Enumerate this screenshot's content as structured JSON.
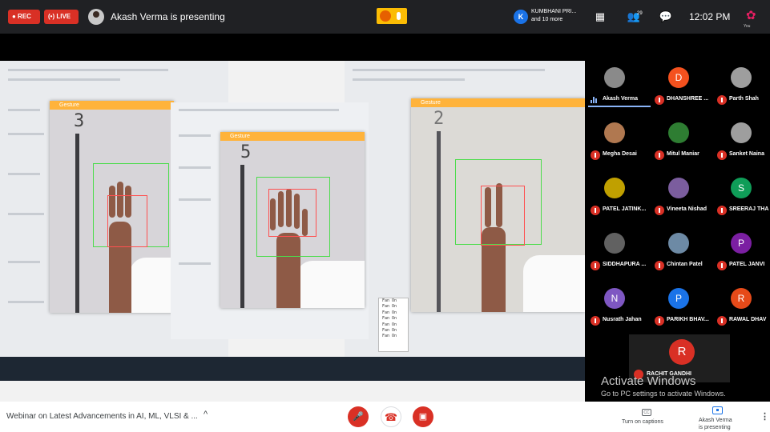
{
  "topbar": {
    "rec_label": "● REC",
    "live_label": "(•) LIVE",
    "presenting": "Akash Verma is presenting",
    "viewer_initial": "K",
    "viewer_name": "KUMBHANI PRI...",
    "viewer_more": "and 10 more",
    "participants_count": "29",
    "chat_badge": "",
    "clock": "12:02 PM",
    "you_label": "You"
  },
  "screen": {
    "window_title": "Gesture",
    "digits": [
      "3",
      "5",
      "2"
    ],
    "fan_log": [
      "Fan On",
      "Fan On",
      "Fan On",
      "Fan On",
      "Fan On",
      "Fan On",
      "Fan On"
    ]
  },
  "watermark": {
    "title": "Activate Windows",
    "subtitle": "Go to PC settings to activate Windows."
  },
  "participants": [
    {
      "name": "Akash Verma",
      "initial": "",
      "color": "#8a8a8a",
      "speaking": true
    },
    {
      "name": "DHANSHREE ...",
      "initial": "D",
      "color": "#f4511e",
      "speaking": false
    },
    {
      "name": "Parth Shah",
      "initial": "",
      "color": "#9e9e9e",
      "speaking": false
    },
    {
      "name": "Megha Desai",
      "initial": "",
      "color": "#b07850",
      "speaking": false
    },
    {
      "name": "Mitul Maniar",
      "initial": "",
      "color": "#2e7d32",
      "speaking": false
    },
    {
      "name": "Sanket Naina",
      "initial": "",
      "color": "#9e9e9e",
      "speaking": false
    },
    {
      "name": "PATEL JATINK...",
      "initial": "",
      "color": "#c0a000",
      "speaking": false
    },
    {
      "name": "Vineeta Nishad",
      "initial": "",
      "color": "#7b5d9e",
      "speaking": false
    },
    {
      "name": "SREERAJ THA",
      "initial": "S",
      "color": "#0f9d58",
      "speaking": false
    },
    {
      "name": "SIDDHAPURA ...",
      "initial": "",
      "color": "#616161",
      "speaking": false
    },
    {
      "name": "Chintan Patel",
      "initial": "",
      "color": "#6d8aa5",
      "speaking": false
    },
    {
      "name": "PATEL JANVI",
      "initial": "P",
      "color": "#7b1fa2",
      "speaking": false
    },
    {
      "name": "Nusrath Jahan",
      "initial": "N",
      "color": "#7e57c2",
      "speaking": false
    },
    {
      "name": "PARIKH BHAV...",
      "initial": "P",
      "color": "#1a73e8",
      "speaking": false
    },
    {
      "name": "RAWAL DHAV",
      "initial": "R",
      "color": "#e64a19",
      "speaking": false
    }
  ],
  "big_tile": {
    "name": "RACHIT GANDHI",
    "initial": "R"
  },
  "bottombar": {
    "meeting_title": "Webinar on Latest Advancements in AI, ML, VLSI & ...",
    "caret": "^",
    "captions_label": "Turn on captions",
    "cc_icon": "CC",
    "present_line1": "Akash Verma",
    "present_line2": "is presenting",
    "more": "⋮"
  }
}
